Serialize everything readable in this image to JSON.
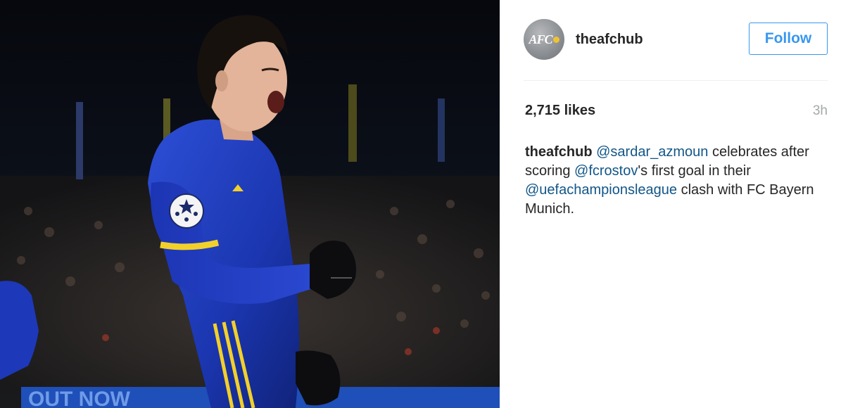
{
  "post": {
    "photo_alt": "Player celebrating a goal",
    "photo_banner_text": "OUT NOW"
  },
  "header": {
    "avatar_text": "AFC",
    "username": "theafchub",
    "follow_label": "Follow"
  },
  "stats": {
    "likes": "2,715 likes",
    "time": "3h"
  },
  "caption": {
    "author": "theafchub",
    "mention_1": "@sardar_azmoun",
    "text_1": " celebrates after scoring ",
    "mention_2": "@fcrostov",
    "text_2": "'s first goal in their ",
    "mention_3": "@uefachampionsleague",
    "text_3": " clash with FC Bayern Munich."
  },
  "colors": {
    "accent": "#3897f0",
    "mention": "#125688",
    "text": "#262626",
    "muted": "#a5a7aa"
  }
}
